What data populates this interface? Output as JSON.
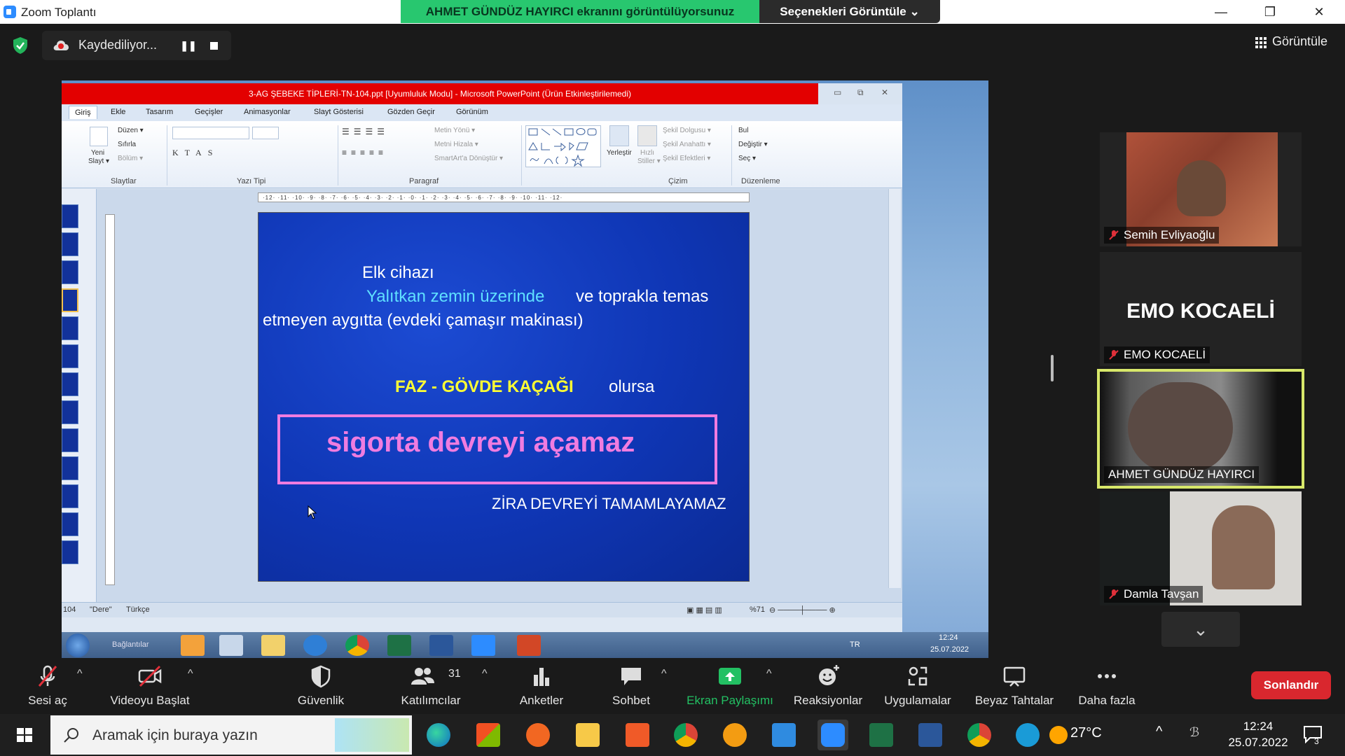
{
  "titlebar": {
    "app_title": "Zoom Toplantı",
    "minimize": "—",
    "restore": "❐",
    "close": "✕"
  },
  "share_banner": "AHMET GÜNDÜZ HAYIRCI ekranını görüntülüyorsunuz",
  "view_options": "Seçenekleri Görüntüle ⌄",
  "recording": {
    "label": "Kaydediliyor...",
    "pause": "❚❚"
  },
  "view_button": "Görüntüle",
  "powerpoint": {
    "title": "3-AG ŞEBEKE TİPLERİ-TN-104.ppt [Uyumluluk Modu] - Microsoft PowerPoint (Ürün Etkinleştirilemedi)",
    "tabs": [
      "Giriş",
      "Ekle",
      "Tasarım",
      "Geçişler",
      "Animasyonlar",
      "Slayt Gösterisi",
      "Gözden Geçir",
      "Görünüm"
    ],
    "ribbon": {
      "duzen": "Düzen ▾",
      "sifirla": "Sıfırla",
      "bolum": "Bölüm ▾",
      "yeni_slayt": "Yeni",
      "yeni_slayt2": "Slayt ▾",
      "metin_yonu": "Metin Yönü ▾",
      "metni_hizala": "Metni Hizala ▾",
      "smartart": "SmartArt'a Dönüştür ▾",
      "yerlestir": "Yerleştir",
      "hizli": "Hızlı",
      "stiller": "Stiller ▾",
      "sekil_dolgusu": "Şekil Dolgusu ▾",
      "sekil_anahatti": "Şekil Anahattı ▾",
      "sekil_efektleri": "Şekil Efektleri ▾",
      "bul": "Bul",
      "degistir": "Değiştir ▾",
      "sec": "Seç ▾",
      "groups": {
        "slaytlar": "Slaytlar",
        "yazi_tipi": "Yazı Tipi",
        "paragraf": "Paragraf",
        "cizim": "Çizim",
        "duzenleme": "Düzenleme"
      }
    },
    "ruler": "·12·  ·11·  ·10·  ·9·  ·8·  ·7·  ·6·  ·5·  ·4·  ·3·  ·2·  ·1·  ·0·  ·1·  ·2·  ·3·  ·4·  ·5·  ·6·  ·7·  ·8·  ·9·  ·10·  ·11·  ·12·",
    "status": {
      "slide": "104",
      "theme": "\"Dere\"",
      "language": "Türkçe",
      "zoom": "%71"
    }
  },
  "slide": {
    "line1": "Elk cihazı",
    "line2_highlight": "Yalıtkan  zemin  üzerinde",
    "line2_rest": "ve topraklа temas",
    "line3": "etmeyen  aygıtta  (evdeki çamaşır makinası)",
    "faz_label": "FAZ - GÖVDE KAÇAĞI",
    "olursa": "olursa",
    "box_text": "sigorta  devreyi  açamaz",
    "footer": "ZİRA  DEVREYİ  TAMAMLAYAMAZ"
  },
  "win7_taskbar": {
    "baglantilar": "Bağlantılar",
    "time": "12:24",
    "date": "25.07.2022",
    "lang": "TR"
  },
  "participants": [
    {
      "name": "Semih Evliyaoğlu"
    },
    {
      "name": "EMO KOCAELİ",
      "display": "EMO KOCAELİ"
    },
    {
      "name": "AHMET GÜNDÜZ HAYIRCI"
    },
    {
      "name": "Damla Tavşan"
    }
  ],
  "toolbar": {
    "audio": "Sesi aç",
    "video": "Videoyu Başlat",
    "security": "Güvenlik",
    "participants": "Katılımcılar",
    "participants_count": "31",
    "polls": "Anketler",
    "chat": "Sohbet",
    "share": "Ekran Paylaşımı",
    "reactions": "Reaksiyonlar",
    "apps": "Uygulamalar",
    "whiteboards": "Beyaz Tahtalar",
    "more": "Daha fazla",
    "end": "Sonlandır"
  },
  "taskbar": {
    "search_placeholder": "Aramak için buraya yazın",
    "temperature": "27°C",
    "time": "12:24",
    "date": "25.07.2022",
    "notifications": "3"
  },
  "colors": {
    "share_green": "#28c76f",
    "end_red": "#d9272e",
    "active_border": "#d8e86a",
    "ppt_title_red": "#e30000"
  }
}
